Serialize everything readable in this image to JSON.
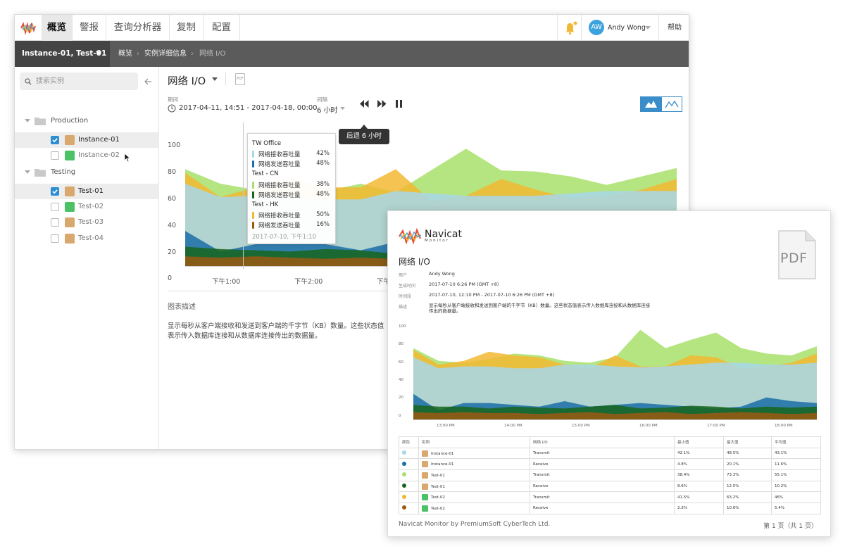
{
  "nav": {
    "tabs": [
      {
        "label": "概览",
        "active": true
      },
      {
        "label": "警报"
      },
      {
        "label": "查询分析器"
      },
      {
        "label": "复制"
      },
      {
        "label": "配置"
      }
    ],
    "user": {
      "initials": "AW",
      "name": "Andy Wong"
    },
    "help": "帮助",
    "icons": {
      "bell": "bell-icon",
      "logo": "navicat-logo"
    }
  },
  "subbar": {
    "selector": "Instance-01, Test-01",
    "breadcrumb": [
      "概览",
      "实例详细信息",
      "网络 I/O"
    ]
  },
  "sidebar": {
    "search_placeholder": "搜索实例",
    "groups": [
      {
        "name": "Production",
        "items": [
          {
            "label": "Instance-01",
            "checked": true
          },
          {
            "label": "Instance-02",
            "checked": false
          }
        ]
      },
      {
        "name": "Testing",
        "items": [
          {
            "label": "Test-01",
            "checked": true
          },
          {
            "label": "Test-02",
            "checked": false
          },
          {
            "label": "Test-03",
            "checked": false
          },
          {
            "label": "Test-04",
            "checked": false
          }
        ]
      }
    ]
  },
  "main": {
    "title": "网络 I/O",
    "pdf_label": "PDF",
    "period_label": "期间",
    "period_value": "2017-04-11, 14:51 - 2017-04-18, 00:00",
    "interval_label": "间隔",
    "interval_value": "6 小时",
    "rewind_tooltip": "后退 6 小时",
    "desc_heading": "图表描述",
    "desc_text": "显示每秒从客户端接收和发送到客户端的千字节（KB）数量。这些状态值表示传入数据库连接和从数据库连接传出的数据量。"
  },
  "tooltip": {
    "groups": [
      {
        "name": "TW Office",
        "rows": [
          {
            "label": "网络接收吞吐量",
            "pct": "42%",
            "color": "#a8d7ea"
          },
          {
            "label": "网络发送吞吐量",
            "pct": "48%",
            "color": "#1a6fa8"
          }
        ]
      },
      {
        "name": "Test - CN",
        "rows": [
          {
            "label": "网络接收吞吐量",
            "pct": "38%",
            "color": "#a8e06a"
          },
          {
            "label": "网络发送吞吐量",
            "pct": "48%",
            "color": "#17651c"
          }
        ]
      },
      {
        "name": "Test - HK",
        "rows": [
          {
            "label": "网络接收吞吐量",
            "pct": "50%",
            "color": "#f2b833"
          },
          {
            "label": "网络发送吞吐量",
            "pct": "16%",
            "color": "#9a5a12"
          }
        ]
      }
    ],
    "footer": "2017-07-10, 下午1:10"
  },
  "report": {
    "brand": "Navicat",
    "brand_sub": "Monitor",
    "title": "网络 I/O",
    "pdf_icon_label": "PDF",
    "meta": [
      {
        "key": "用户",
        "value": "Andy Wong"
      },
      {
        "key": "生成时间",
        "value": "2017-07-10 6:26 PM (GMT +8)"
      },
      {
        "key": "时间段",
        "value": "2017-07-10, 12:10 PM - 2017-07-10 6:26 PM (GMT +8)"
      },
      {
        "key": "描述",
        "value": "显示每秒从客户端接收和发送到客户端的千字节（KB）数量。这些状态值表示传入数据库连接和从数据库连接传出的数据量。"
      }
    ],
    "table": {
      "headers": [
        "颜色",
        "实例",
        "网络 I/O",
        "最小值",
        "最大值",
        "平均值"
      ],
      "rows": [
        {
          "color": "#a8d7ea",
          "instance": "Instance-01",
          "type": "Transmit",
          "min": "42.1%",
          "max": "48.5%",
          "avg": "43.1%",
          "icon": "tan"
        },
        {
          "color": "#1a6fa8",
          "instance": "Instance-01",
          "type": "Receive",
          "min": "4.8%",
          "max": "20.1%",
          "avg": "11.6%",
          "icon": "tan"
        },
        {
          "color": "#a8e06a",
          "instance": "Test-01",
          "type": "Transmit",
          "min": "38.4%",
          "max": "73.3%",
          "avg": "55.1%",
          "icon": "tan"
        },
        {
          "color": "#17651c",
          "instance": "Test-01",
          "type": "Receive",
          "min": "8.6%",
          "max": "12.5%",
          "avg": "10.2%",
          "icon": "tan"
        },
        {
          "color": "#f2b833",
          "instance": "Test-02",
          "type": "Transmit",
          "min": "41.5%",
          "max": "63.2%",
          "avg": "46%",
          "icon": "green"
        },
        {
          "color": "#9a5a12",
          "instance": "Test-02",
          "type": "Receive",
          "min": "2.3%",
          "max": "10.6%",
          "avg": "5.4%",
          "icon": "green"
        }
      ]
    },
    "footer_left": "Navicat Monitor by PremiumSoft CyberTech Ltd.",
    "footer_right": "第 1 页（共 1 页）"
  },
  "chart_data": [
    {
      "type": "area",
      "ylim": [
        0,
        100
      ],
      "yticks": [
        "100",
        "80",
        "60",
        "40",
        "20",
        "0"
      ],
      "xticks": [
        "下午1:00",
        "下午2:00",
        "下午3:00"
      ],
      "series": [
        {
          "color": "#a8e06a",
          "values": [
            80,
            68,
            63,
            62,
            62,
            68,
            61,
            79,
            97,
            79,
            78,
            74,
            67,
            74,
            81
          ]
        },
        {
          "color": "#f2b833",
          "values": [
            77,
            57,
            65,
            73,
            65,
            65,
            80,
            54,
            58,
            72,
            63,
            56,
            58,
            63,
            72
          ]
        },
        {
          "color": "#a8d7ea",
          "values": [
            68,
            57,
            58,
            58,
            55,
            55,
            62,
            60,
            58,
            58,
            58,
            60,
            62,
            62,
            62
          ]
        },
        {
          "color": "#1a6fa8",
          "values": [
            29,
            12,
            18,
            20,
            18,
            13,
            20,
            15,
            18,
            20,
            18,
            15,
            18,
            20,
            18
          ]
        },
        {
          "color": "#17651c",
          "values": [
            16,
            14,
            13,
            12,
            14,
            13,
            10,
            13,
            15,
            12,
            13,
            14,
            12,
            13,
            14
          ]
        },
        {
          "color": "#9a5a12",
          "values": [
            8,
            7,
            8,
            7,
            6,
            7,
            6,
            8,
            7,
            6,
            7,
            8,
            7,
            6,
            7
          ]
        }
      ]
    },
    {
      "type": "area",
      "ylim": [
        0,
        100
      ],
      "yticks": [
        "100",
        "80",
        "60",
        "40",
        "20",
        "0"
      ],
      "xticks": [
        "13:00 PM",
        "14:00 PM",
        "15:00 PM",
        "16:00 PM",
        "17:00 PM",
        "18:00 PM"
      ],
      "series": [
        {
          "color": "#a8e06a",
          "values": [
            78,
            64,
            62,
            66,
            72,
            70,
            64,
            62,
            68,
            98,
            78,
            87,
            95,
            78,
            72,
            70,
            80
          ]
        },
        {
          "color": "#f2b833",
          "values": [
            76,
            60,
            64,
            74,
            70,
            68,
            60,
            56,
            70,
            58,
            58,
            70,
            68,
            56,
            58,
            62,
            72
          ]
        },
        {
          "color": "#a8d7ea",
          "values": [
            68,
            56,
            58,
            58,
            56,
            56,
            60,
            60,
            58,
            57,
            58,
            60,
            62,
            62,
            60,
            60,
            62
          ]
        },
        {
          "color": "#1a6fa8",
          "values": [
            28,
            10,
            18,
            18,
            16,
            14,
            20,
            14,
            16,
            18,
            16,
            14,
            12,
            14,
            24,
            20,
            18
          ]
        },
        {
          "color": "#17651c",
          "values": [
            16,
            14,
            14,
            12,
            14,
            13,
            12,
            14,
            16,
            12,
            13,
            15,
            14,
            12,
            14,
            13,
            14
          ]
        },
        {
          "color": "#9a5a12",
          "values": [
            8,
            7,
            8,
            7,
            7,
            6,
            7,
            8,
            6,
            7,
            8,
            6,
            7,
            8,
            7,
            6,
            7
          ]
        }
      ]
    }
  ]
}
